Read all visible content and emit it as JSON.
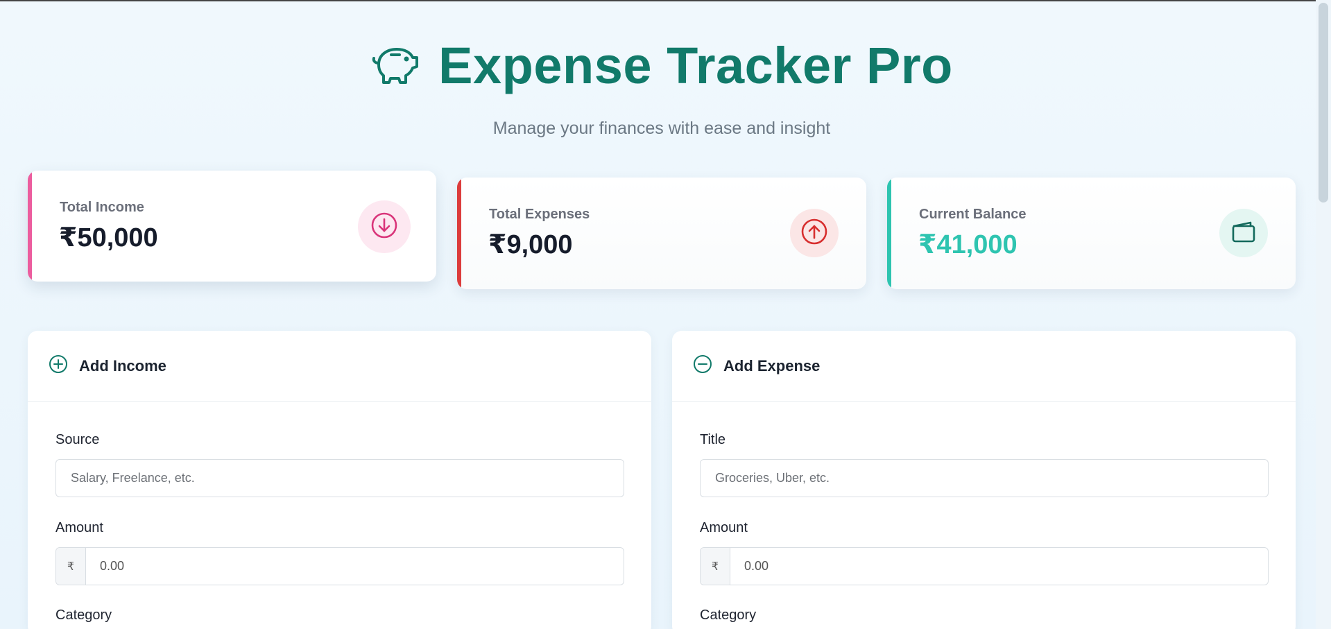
{
  "header": {
    "logo_icon": "piggy-bank-icon",
    "title": "Expense Tracker Pro",
    "subtitle": "Manage your finances with ease and insight"
  },
  "summary": {
    "income": {
      "label": "Total Income",
      "value": "₹50,000",
      "icon": "arrow-down-circle-icon",
      "accent": "#ec5d9e"
    },
    "expenses": {
      "label": "Total Expenses",
      "value": "₹9,000",
      "icon": "arrow-up-circle-icon",
      "accent": "#dc3c3c"
    },
    "balance": {
      "label": "Current Balance",
      "value": "₹41,000",
      "icon": "wallet-icon",
      "accent": "#2ec4b0"
    }
  },
  "add_income": {
    "title": "Add Income",
    "icon": "plus-circle-icon",
    "source_label": "Source",
    "source_placeholder": "Salary, Freelance, etc.",
    "amount_label": "Amount",
    "amount_prefix": "₹",
    "amount_placeholder": "0.00",
    "category_label": "Category"
  },
  "add_expense": {
    "title": "Add Expense",
    "icon": "minus-circle-icon",
    "title_label": "Title",
    "title_placeholder": "Groceries, Uber, etc.",
    "amount_label": "Amount",
    "amount_prefix": "₹",
    "amount_placeholder": "0.00",
    "category_label": "Category"
  }
}
